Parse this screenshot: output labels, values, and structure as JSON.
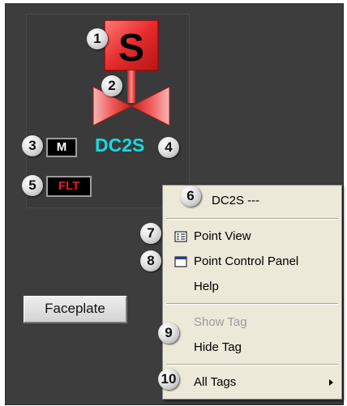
{
  "graphic": {
    "mode_label": "M",
    "fault_label": "FLT",
    "tag_name": "DC2S",
    "solenoid_letter": "S",
    "faceplate_button": "Faceplate",
    "tag_color": "#17d9e4",
    "fault_color": "#e81c1c",
    "valve_color": "#e83a3a"
  },
  "callouts": [
    "1",
    "2",
    "3",
    "4",
    "5",
    "6",
    "7",
    "8",
    "9",
    "10"
  ],
  "menu": {
    "header": "DC2S ---",
    "point_view": "Point View",
    "point_control_panel": "Point Control Panel",
    "help": "Help",
    "show_tag": "Show Tag",
    "hide_tag": "Hide Tag",
    "all_tags": "All Tags"
  }
}
